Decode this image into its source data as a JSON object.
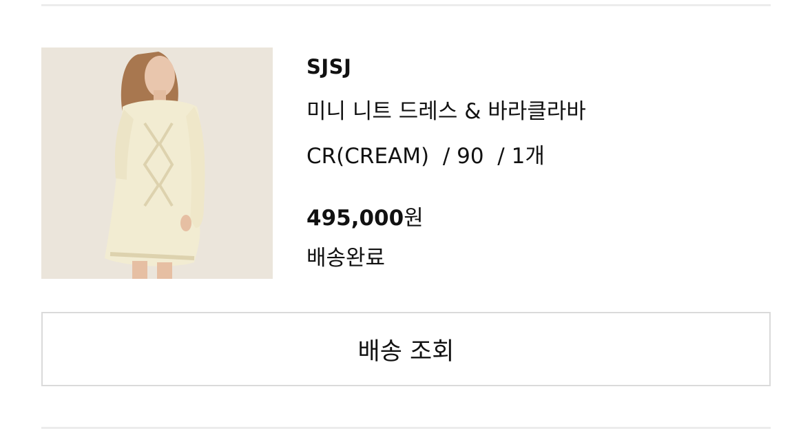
{
  "order_item": {
    "brand": "SJSJ",
    "product_name": "미니 니트 드레스 & 바라클라바",
    "option": {
      "color": "CR(CREAM)",
      "size": "90",
      "quantity": "1개"
    },
    "price": {
      "amount": "495,000",
      "currency": "원"
    },
    "status": "배송완료",
    "image_icon": "product-photo-knit-dress"
  },
  "actions": {
    "track_shipping_label": "배송 조회"
  }
}
